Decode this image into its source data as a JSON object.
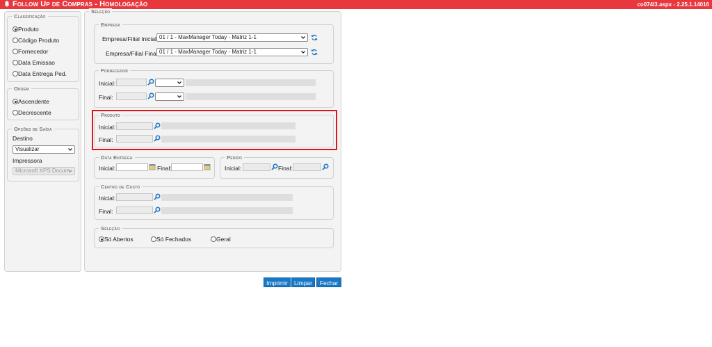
{
  "titlebar": {
    "title": "Follow Up de Compras  - Homologação",
    "version": "co074l3.aspx - 2.25.1.14016",
    "color": "#e8383e"
  },
  "left": {
    "classificacao": {
      "legend": "Classificação",
      "options": [
        "Produto",
        "Código Produto",
        "Fornecedor",
        "Data Emissao",
        "Data Entrega Ped."
      ],
      "selected": "Produto"
    },
    "ordem": {
      "legend": "Ordem",
      "options": [
        "Ascendente",
        "Decrescente"
      ],
      "selected": "Ascendente"
    },
    "saida": {
      "legend": "Opções de Saída",
      "destino_label": "Destino",
      "destino_value": "Visualizar",
      "impressora_label": "Impressora",
      "impressora_value": "Microsoft XPS Docum"
    }
  },
  "main": {
    "legend": "Seleção",
    "empresa": {
      "legend": "Empresa",
      "inicial_label": "Empresa/Filial Inicial:",
      "inicial_value": "01 / 1 - MaxManager Today - Matriz 1-1",
      "final_label": "Empresa/Filial Final:",
      "final_value": "01 / 1 - MaxManager Today - Matriz 1-1"
    },
    "fornecedor": {
      "legend": "Fornecedor",
      "inicial_label": "Inicial:",
      "final_label": "Final:"
    },
    "produto": {
      "legend": "Produto",
      "inicial_label": "Inicial:",
      "final_label": "Final:"
    },
    "data_entrega": {
      "legend": "Data Entrega",
      "inicial_label": "Inicial:",
      "final_label": "Final:"
    },
    "pedido": {
      "legend": "Pedido",
      "inicial_label": "Inicial:",
      "final_label": "Final:"
    },
    "centro_custo": {
      "legend": "Centro de Custo",
      "inicial_label": "Inicial:",
      "final_label": "Final:"
    },
    "selecao": {
      "legend": "Seleção",
      "options": [
        "Só Abertos",
        "Só Fechados",
        "Geral"
      ],
      "selected": "Só Abertos"
    }
  },
  "buttons": {
    "imprimir": "Imprimir",
    "limpar": "Limpar",
    "fechar": "Fechar",
    "color": "#1a79c6"
  },
  "highlight_color": "#e0151b"
}
